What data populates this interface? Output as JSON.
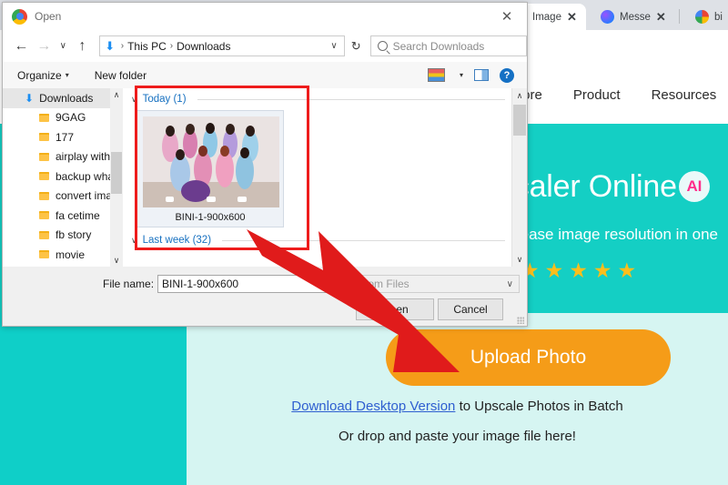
{
  "browser": {
    "tabs": [
      {
        "label": "Image",
        "favicon": "upscaler-icon",
        "close": "✕",
        "active": true
      },
      {
        "label": "Messe",
        "favicon": "messenger-icon",
        "close": "✕",
        "active": false
      },
      {
        "label": "bi",
        "favicon": "google-icon",
        "close": "",
        "active": false
      }
    ]
  },
  "site": {
    "nav": [
      "Store",
      "Product",
      "Resources"
    ],
    "hero_title": "scaler Online",
    "hero_badge": "AI",
    "hero_subtitle": "ncrease image resolution in one",
    "stars": [
      "★",
      "★",
      "★",
      "★",
      "★"
    ],
    "upload_button": "Upload Photo",
    "link_text": "Download Desktop Version",
    "link_suffix": " to Upscale Photos in Batch",
    "drop_text": "Or drop and paste your image file here!",
    "colors": {
      "teal": "#14cfc4",
      "panel": "#d6f5f2",
      "orange": "#f59c18",
      "link": "#2f5fd0",
      "star": "#fdbe1b"
    }
  },
  "dialog": {
    "title": "Open",
    "close": "✕",
    "nav": {
      "back": "←",
      "forward": "→",
      "recent": "∨",
      "up": "↑",
      "refresh": "↻",
      "breadcrumb": [
        "This PC",
        "Downloads"
      ],
      "breadcrumb_sep": "›",
      "dropdown": "∨"
    },
    "search_placeholder": "Search Downloads",
    "toolbar": {
      "organize": "Organize",
      "organize_caret": "▾",
      "new_folder": "New folder",
      "view_icon": "view-options-icon",
      "view_caret": "▾",
      "pane_icon": "preview-pane-icon",
      "help_icon": "?"
    },
    "tree": {
      "root": {
        "label": "Downloads",
        "icon": "download-arrow-icon"
      },
      "items": [
        "9GAG",
        "177",
        "airplay without",
        "backup whatsa",
        "convert image",
        "fa cetime",
        "fb story",
        "movie"
      ],
      "scroll_up": "∧",
      "scroll_down": "∨"
    },
    "files": {
      "groups": [
        {
          "label": "Today (1)",
          "chevron": "∨"
        },
        {
          "label": "Last week (32)",
          "chevron": "∨"
        }
      ],
      "selected_file": "BINI-1-900x600",
      "scroll_up": "∧",
      "scroll_down": "∨"
    },
    "footer": {
      "file_name_label": "File name:",
      "file_name_value": "BINI-1-900x600",
      "file_type_value": "stom Files",
      "file_type_chevron": "∨",
      "open_button": "Open",
      "cancel_button": "Cancel"
    }
  },
  "annotation": {
    "highlight_color": "#ee1c1c",
    "arrow_color": "#e01b1b"
  }
}
